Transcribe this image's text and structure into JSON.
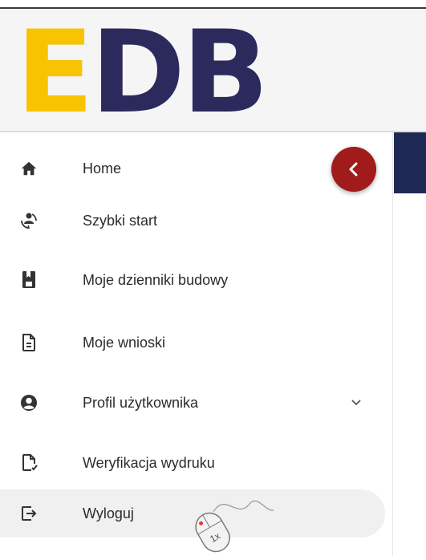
{
  "header": {
    "logo": {
      "letter1": "E",
      "letters_rest": "DB"
    }
  },
  "sidebar": {
    "collapse_icon": "chevron-left-icon",
    "items": [
      {
        "label": "Home",
        "icon": "home-icon"
      },
      {
        "label": "Szybki start",
        "icon": "quick-start-icon"
      },
      {
        "label": "Moje dzienniki budowy",
        "icon": "book-icon"
      },
      {
        "label": "Moje wnioski",
        "icon": "document-icon"
      },
      {
        "label": "Profil użytkownika",
        "icon": "user-circle-icon",
        "expand_icon": "chevron-down-icon"
      },
      {
        "label": "Weryfikacja wydruku",
        "icon": "document-check-icon"
      },
      {
        "label": "Wyloguj",
        "icon": "logout-icon",
        "active": true
      }
    ]
  },
  "cursor": {
    "label": "1x"
  },
  "colors": {
    "logo_yellow": "#f8c300",
    "logo_navy": "#2c2a5c",
    "collapse_red": "#a11b1b",
    "band_navy": "#1e2a55"
  }
}
